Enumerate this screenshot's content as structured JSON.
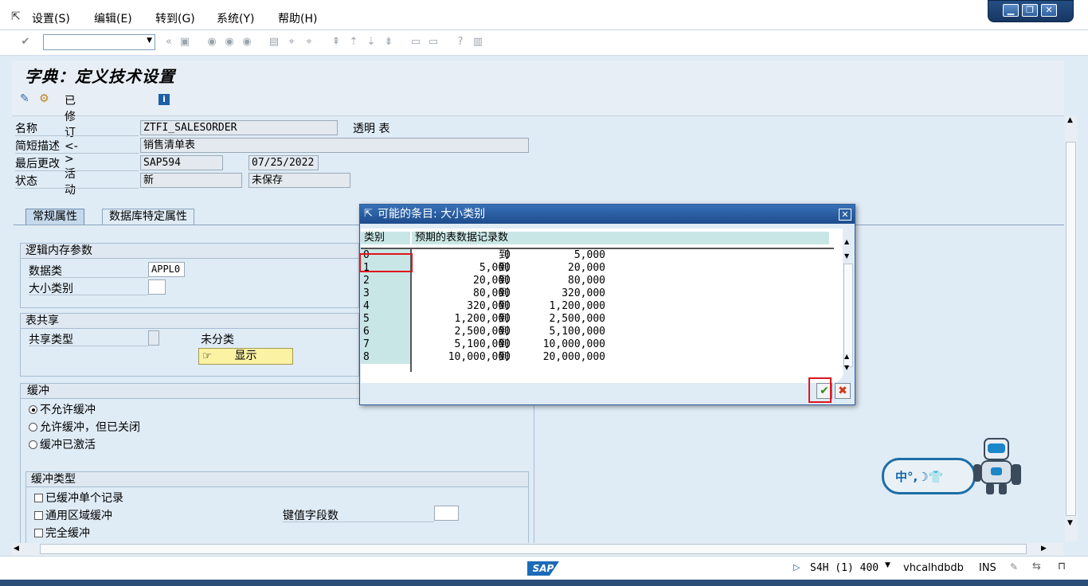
{
  "menu": {
    "items": [
      "设置(S)",
      "编辑(E)",
      "转到(G)",
      "系统(Y)",
      "帮助(H)"
    ]
  },
  "window_controls": {
    "minimize": "▁",
    "restore": "❐",
    "close": "✕"
  },
  "toolbar": {
    "command_field_value": ""
  },
  "page": {
    "title": "字典：定义技术设置",
    "revised_active_label": "已修订<->活动"
  },
  "form": {
    "name_label": "名称",
    "name_value": "ZTFI_SALESORDER",
    "name_type": "透明 表",
    "desc_label": "简短描述",
    "desc_value": "销售清单表",
    "lastchange_label": "最后更改",
    "lastchange_user": "SAP594",
    "lastchange_date": "07/25/2022",
    "status_label": "状态",
    "status_value": "新",
    "status_save": "未保存"
  },
  "tabs": [
    {
      "label": "常规属性"
    },
    {
      "label": "数据库特定属性"
    }
  ],
  "groups": {
    "logical": {
      "title": "逻辑内存参数",
      "dataclass_label": "数据类",
      "dataclass_value": "APPL0",
      "sizecat_label": "大小类别",
      "sizecat_value": ""
    },
    "sharing": {
      "title": "表共享",
      "type_label": "共享类型",
      "unclassified": "未分类",
      "display_button": "显示"
    },
    "buffering": {
      "title": "缓冲",
      "options": [
        "不允许缓冲",
        "允许缓冲，但已关闭",
        "缓冲已激活"
      ],
      "selected": 0
    },
    "buffer_type": {
      "title": "缓冲类型",
      "options": [
        "已缓冲单个记录",
        "通用区域缓冲",
        "完全缓冲"
      ],
      "key_fields_label": "键值字段数",
      "key_fields_value": ""
    }
  },
  "dialog": {
    "title": "可能的条目: 大小类别",
    "col_category": "类别",
    "col_expected": "预期的表数据记录数",
    "rows": [
      {
        "cat": "0",
        "from": "0",
        "to": "到",
        "upto": "5,000"
      },
      {
        "cat": "1",
        "from": "5,000",
        "to": "到",
        "upto": "20,000"
      },
      {
        "cat": "2",
        "from": "20,000",
        "to": "到",
        "upto": "80,000"
      },
      {
        "cat": "3",
        "from": "80,000",
        "to": "到",
        "upto": "320,000"
      },
      {
        "cat": "4",
        "from": "320,000",
        "to": "到",
        "upto": "1,200,000"
      },
      {
        "cat": "5",
        "from": "1,200,000",
        "to": "到",
        "upto": "2,500,000"
      },
      {
        "cat": "6",
        "from": "2,500,000",
        "to": "到",
        "upto": "5,100,000"
      },
      {
        "cat": "7",
        "from": "5,100,000",
        "to": "到",
        "upto": "10,000,000"
      },
      {
        "cat": "8",
        "from": "10,000,000",
        "to": "到",
        "upto": "20,000,000"
      }
    ],
    "ok_symbol": "✔",
    "cancel_symbol": "✖"
  },
  "statusbar": {
    "sap_logo": "SAP",
    "system": "S4H (1) 400",
    "host": "vhcalhdbdb",
    "mode": "INS"
  },
  "assistant": {
    "text": "中°,☽👕"
  }
}
